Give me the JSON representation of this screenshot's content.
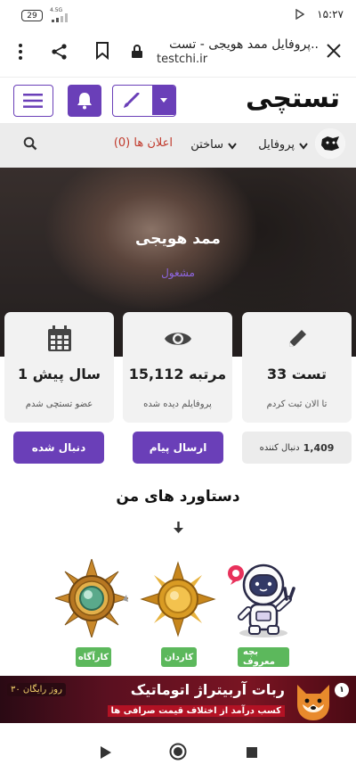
{
  "status_bar": {
    "time": "۱۵:۲۷",
    "battery": "29",
    "network": "4.5G"
  },
  "browser": {
    "page_title": "پروفایل ممد هویجی - تست..",
    "domain": "testchi.ir"
  },
  "site": {
    "logo_text": "تستچی"
  },
  "nav": {
    "profile": "پروفایل",
    "build": "ساختن",
    "notifications": "اعلان ها (0)"
  },
  "profile": {
    "name": "ممد هویجی",
    "status": "مشغول"
  },
  "stats": [
    {
      "value": "33 تست",
      "caption": "تا الان ثبت کردم",
      "icon": "pencil-icon"
    },
    {
      "value": "15,112 مرتبه",
      "caption": "پروفایلم دیده شده",
      "icon": "eye-icon"
    },
    {
      "value": "1 سال پیش",
      "caption": "عضو تستچی شدم",
      "icon": "calendar-icon"
    }
  ],
  "actions": {
    "followers_count": "1,409",
    "followers_label": "دنبال کننده",
    "send_message": "ارسال پیام",
    "following": "دنبال شده"
  },
  "achievements": {
    "title": "دستاورد های من",
    "items": [
      {
        "label": "بچه معروف",
        "icon": "astronaut-icon"
      },
      {
        "label": "کاردان",
        "icon": "gold-medal-icon"
      },
      {
        "label": "کارآگاه",
        "icon": "emerald-medal-icon"
      }
    ]
  },
  "ad": {
    "headline": "ربات آربیتراژ اتوماتیک",
    "sub": "کسب درآمد از اختلاف قیمت صرافی ها",
    "trial": "۳۰ روز رایگان",
    "badge": "۱"
  },
  "colors": {
    "brand_purple": "#6a3fb8",
    "nav_red": "#c0392b",
    "badge_green": "#5cb85c"
  }
}
